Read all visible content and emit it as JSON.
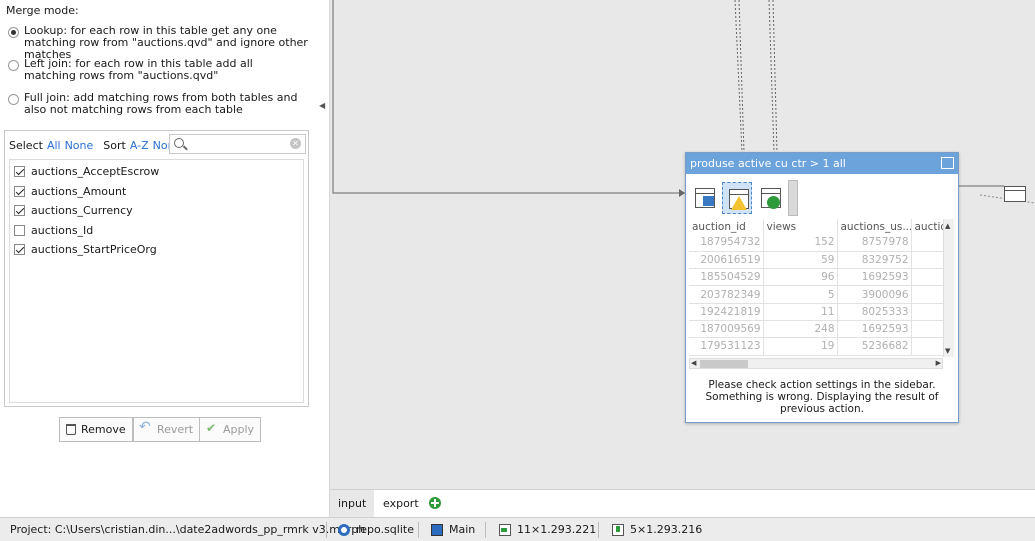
{
  "sidebar": {
    "merge_mode_label": "Merge mode:",
    "options": [
      {
        "label": "Lookup: for each row in this table get any one matching row from \"auctions.qvd\" and ignore other matches",
        "selected": true
      },
      {
        "label": "Left join: for each row in this table add all matching rows from \"auctions.qvd\"",
        "selected": false
      },
      {
        "label": "Full join: add matching rows from both tables and also not matching rows from each table",
        "selected": false
      }
    ],
    "select_label": "Select",
    "select_all": "All",
    "select_none": "None",
    "sort_label": "Sort",
    "sort_az": "A-Z",
    "sort_none": "None",
    "search_placeholder": "",
    "fields": [
      {
        "name": "auctions_AcceptEscrow",
        "checked": true
      },
      {
        "name": "auctions_Amount",
        "checked": true
      },
      {
        "name": "auctions_Currency",
        "checked": true
      },
      {
        "name": "auctions_Id",
        "checked": false
      },
      {
        "name": "auctions_StartPriceOrg",
        "checked": true
      }
    ],
    "buttons": {
      "remove": "Remove",
      "revert": "Revert",
      "apply": "Apply"
    }
  },
  "node": {
    "title": "produse active cu ctr > 1 all",
    "columns": [
      "auction_id",
      "views",
      "auctions_us...",
      "auctio"
    ],
    "rows": [
      [
        "187954732",
        "152",
        "8757978"
      ],
      [
        "200616519",
        "59",
        "8329752"
      ],
      [
        "185504529",
        "96",
        "1692593"
      ],
      [
        "203782349",
        "5",
        "3900096"
      ],
      [
        "192421819",
        "11",
        "8025333"
      ],
      [
        "187009569",
        "248",
        "1692593"
      ],
      [
        "179531123",
        "19",
        "5236682"
      ]
    ],
    "message": "Please check action settings in the sidebar. Something is wrong. Displaying the result of previous action."
  },
  "tabs": [
    {
      "label": "input",
      "active": true
    },
    {
      "label": "export",
      "active": false
    }
  ],
  "statusbar": {
    "project": "Project:  C:\\Users\\cristian.din...\\date2adwords_pp_rmrk v3.morph",
    "repo": "repo.sqlite",
    "flow": "Main",
    "input_dims": "11×1.293.221",
    "output_dims": "5×1.293.216"
  },
  "colors": {
    "accent": "#6ba3da",
    "link": "#2a6fd1",
    "canvas": "#e8e8e8"
  }
}
